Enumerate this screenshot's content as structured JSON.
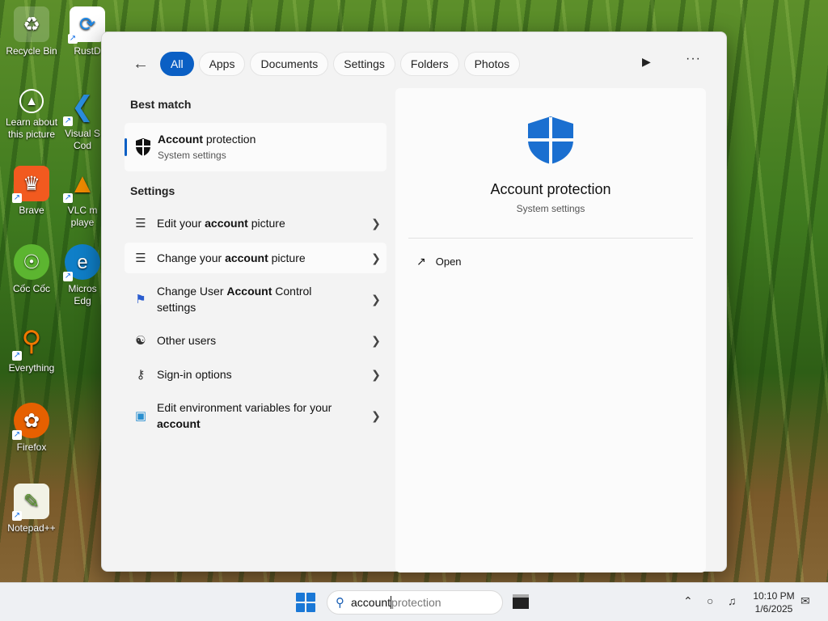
{
  "desktop": {
    "icons": [
      {
        "label": "Recycle Bin",
        "icon": "recycle-bin-icon"
      },
      {
        "label": "RustD",
        "icon": "rustdesk-icon"
      },
      {
        "label": "Learn about this picture",
        "icon": "learn-picture-icon"
      },
      {
        "label": "Visual S Cod",
        "icon": "vscode-icon"
      },
      {
        "label": "Brave",
        "icon": "brave-icon"
      },
      {
        "label": "VLC m playe",
        "icon": "vlc-icon"
      },
      {
        "label": "Cốc Cốc",
        "icon": "coccoc-icon"
      },
      {
        "label": "Micros Edg",
        "icon": "edge-icon"
      },
      {
        "label": "Everything",
        "icon": "everything-icon"
      },
      {
        "label": "Firefox",
        "icon": "firefox-icon"
      },
      {
        "label": "Notepad++",
        "icon": "notepadpp-icon"
      }
    ]
  },
  "search": {
    "filters": [
      "All",
      "Apps",
      "Documents",
      "Settings",
      "Folders",
      "Photos"
    ],
    "active_filter": "All",
    "best_match_heading": "Best match",
    "best_match": {
      "title_bold": "Account",
      "title_rest": " protection",
      "subtitle": "System settings"
    },
    "settings_heading": "Settings",
    "results": [
      {
        "pre": "Edit your ",
        "bold": "account",
        "post": " picture",
        "post2": "",
        "icon": "account-picture-icon"
      },
      {
        "pre": "Change your ",
        "bold": "account",
        "post": " picture",
        "post2": "",
        "icon": "account-picture-icon"
      },
      {
        "pre": "Change User ",
        "bold": "Account",
        "post": " Control",
        "post2": "settings",
        "icon": "uac-flag-icon"
      },
      {
        "pre": "Other users",
        "bold": "",
        "post": "",
        "post2": "",
        "icon": "other-users-icon"
      },
      {
        "pre": "Sign-in options",
        "bold": "",
        "post": "",
        "post2": "",
        "icon": "key-icon"
      },
      {
        "pre": "Edit environment variables for your",
        "bold": "",
        "post": "",
        "post2": "account",
        "icon": "monitor-icon"
      }
    ]
  },
  "preview": {
    "title": "Account protection",
    "subtitle": "System settings",
    "open_label": "Open"
  },
  "taskbar": {
    "search_typed": "account",
    "search_ghost": " protection",
    "time": "10:10 PM",
    "date": "1/6/2025"
  },
  "colors": {
    "accent": "#0a5fc4",
    "shield": "#1a6fd0"
  }
}
